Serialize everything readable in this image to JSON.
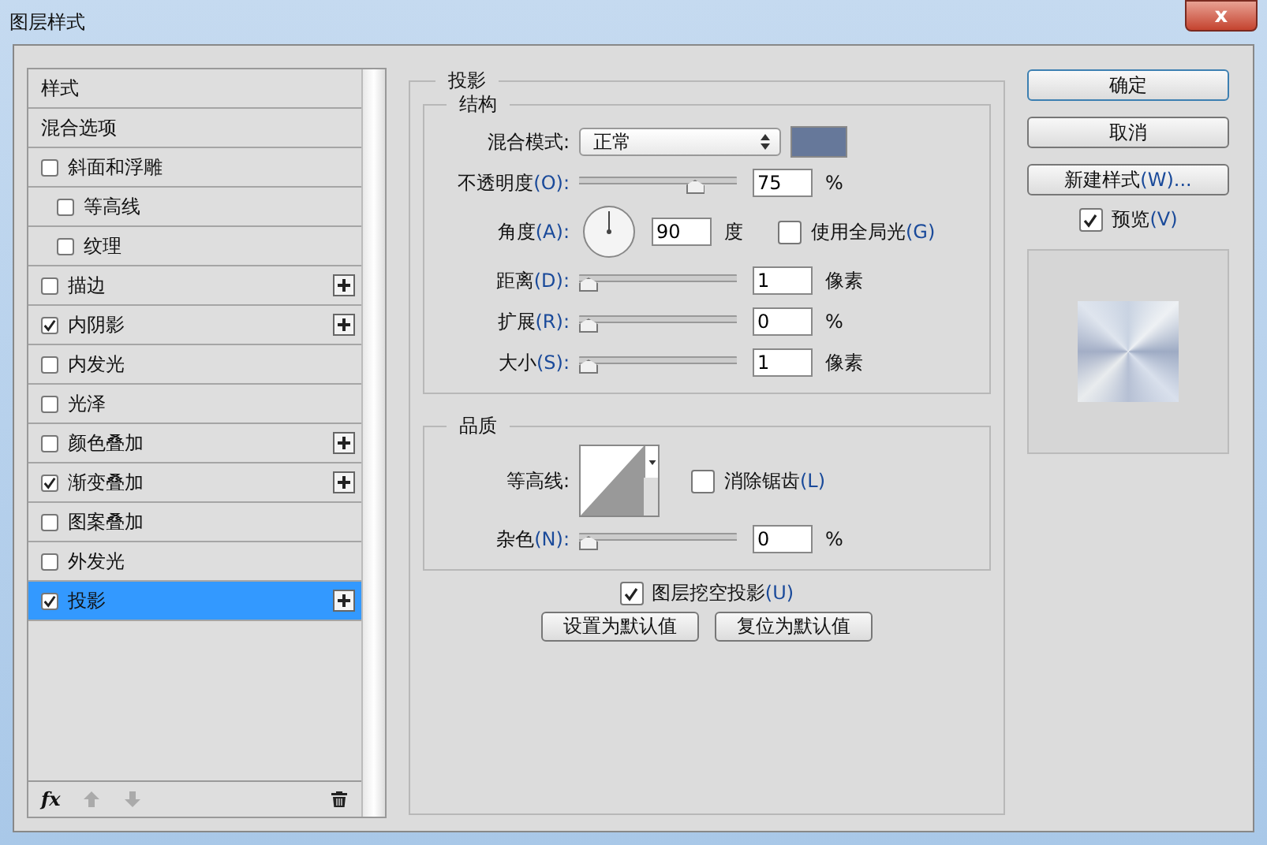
{
  "window": {
    "title": "图层样式",
    "close": "x"
  },
  "styles": [
    {
      "label": "样式",
      "kind": "header",
      "selected": false
    },
    {
      "label": "混合选项",
      "kind": "header",
      "selected": false
    },
    {
      "label": "斜面和浮雕",
      "kind": "check",
      "checked": false,
      "add": false,
      "selected": false,
      "children": [
        {
          "label": "等高线",
          "kind": "check",
          "checked": false,
          "add": false,
          "selected": false
        },
        {
          "label": "纹理",
          "kind": "check",
          "checked": false,
          "add": false,
          "selected": false
        }
      ]
    },
    {
      "label": "描边",
      "kind": "check",
      "checked": false,
      "add": true,
      "selected": false
    },
    {
      "label": "内阴影",
      "kind": "check",
      "checked": true,
      "add": true,
      "selected": false
    },
    {
      "label": "内发光",
      "kind": "check",
      "checked": false,
      "add": false,
      "selected": false
    },
    {
      "label": "光泽",
      "kind": "check",
      "checked": false,
      "add": false,
      "selected": false
    },
    {
      "label": "颜色叠加",
      "kind": "check",
      "checked": false,
      "add": true,
      "selected": false
    },
    {
      "label": "渐变叠加",
      "kind": "check",
      "checked": true,
      "add": true,
      "selected": false
    },
    {
      "label": "图案叠加",
      "kind": "check",
      "checked": false,
      "add": false,
      "selected": false
    },
    {
      "label": "外发光",
      "kind": "check",
      "checked": false,
      "add": false,
      "selected": false
    },
    {
      "label": "投影",
      "kind": "check",
      "checked": true,
      "add": true,
      "selected": true
    }
  ],
  "list_footer": {
    "fx": "fx"
  },
  "panel": {
    "title": "投影",
    "structure": {
      "title": "结构",
      "blend_mode": {
        "label": "混合模式:",
        "value": "正常",
        "color": "#66789a"
      },
      "opacity": {
        "label": "不透明度",
        "key": "(O):",
        "level": 0.75,
        "value": "75",
        "unit": "%"
      },
      "angle": {
        "label": "角度",
        "key": "(A):",
        "value": "90",
        "unit": "度",
        "global_light": {
          "label": "使用全局光",
          "key": "(G)",
          "checked": false
        }
      },
      "sliders": [
        {
          "label": "距离",
          "key": "(D):",
          "level": 0,
          "value": "1",
          "unit": "像素"
        },
        {
          "label": "扩展",
          "key": "(R):",
          "level": 0,
          "value": "0",
          "unit": "%"
        },
        {
          "label": "大小",
          "key": "(S):",
          "level": 0,
          "value": "1",
          "unit": "像素"
        }
      ]
    },
    "quality": {
      "title": "品质",
      "contour_label": "等高线:",
      "antialias": {
        "label": "消除锯齿",
        "key": "(L)",
        "checked": false
      },
      "noise": {
        "label": "杂色",
        "key": "(N):",
        "level": 0,
        "value": "0",
        "unit": "%"
      }
    },
    "knockout": {
      "label": "图层挖空投影",
      "key": "(U)",
      "checked": true
    },
    "buttons": [
      "设置为默认值",
      "复位为默认值"
    ]
  },
  "side": {
    "buttons": [
      "确定",
      "取消"
    ],
    "new_style": {
      "label": "新建样式",
      "key": "(W)..."
    },
    "preview": {
      "label": "预览",
      "key": "(V)",
      "checked": true
    }
  }
}
